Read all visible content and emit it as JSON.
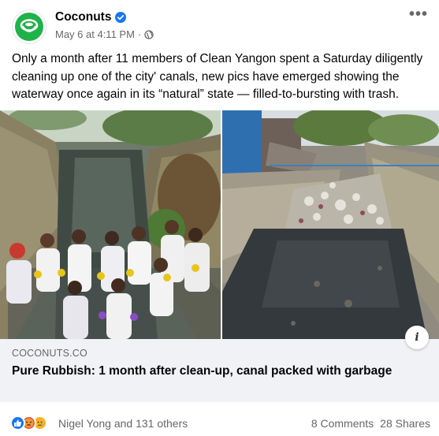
{
  "post": {
    "page_name": "Coconuts",
    "timestamp": "May 6 at 4:11 PM",
    "separator": "·",
    "text": "Only a month after 11 members of Clean Yangon spent a Saturday diligently cleaning up one of the city' canals, new pics have emerged showing the waterway once again in its “natural” state — filled-to-bursting with trash.",
    "menu_glyph": "•••"
  },
  "link": {
    "domain": "COCONUTS.CO",
    "title": "Pure Rubbish: 1 month after clean-up, canal packed with garbage",
    "info_glyph": "i"
  },
  "footer": {
    "reaction_names": "Nigel Yong and 131 others",
    "comments": "8 Comments",
    "shares": "28 Shares"
  },
  "icons": {
    "avatar": "coconuts-logo-icon",
    "verified": "verified-badge-icon",
    "audience": "globe-icon",
    "reactions": [
      "like-icon",
      "angry-icon",
      "sad-icon"
    ]
  },
  "colors": {
    "brand_green": "#1fb24a",
    "verified_blue": "#1877f2",
    "secondary_text": "#65676b",
    "link_bg": "#f0f2f5"
  }
}
